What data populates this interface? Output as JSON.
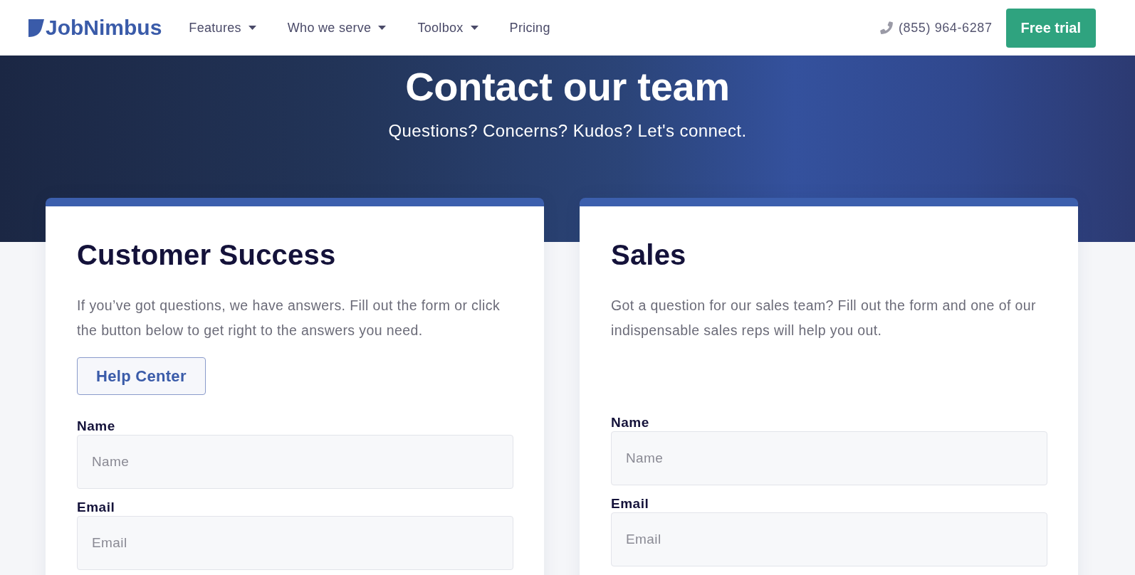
{
  "header": {
    "logo": "JobNimbus",
    "nav": [
      {
        "label": "Features",
        "dropdown": true
      },
      {
        "label": "Who we serve",
        "dropdown": true
      },
      {
        "label": "Toolbox",
        "dropdown": true
      },
      {
        "label": "Pricing",
        "dropdown": false
      }
    ],
    "phone": "(855) 964-6287",
    "cta": "Free trial"
  },
  "hero": {
    "title": "Contact our team",
    "subtitle": "Questions? Concerns? Kudos? Let's connect."
  },
  "cards": [
    {
      "title": "Customer Success",
      "description": "If you’ve got questions, we have answers. Fill out the form or click the button below to get right to the answers you need.",
      "button": "Help Center",
      "fields": [
        {
          "label": "Name",
          "placeholder": "Name"
        },
        {
          "label": "Email",
          "placeholder": "Email"
        }
      ]
    },
    {
      "title": "Sales",
      "description": "Got a question for our sales team? Fill out the form and one of our indispensable sales reps will help you out.",
      "fields": [
        {
          "label": "Name",
          "placeholder": "Name"
        },
        {
          "label": "Email",
          "placeholder": "Email"
        }
      ]
    }
  ]
}
